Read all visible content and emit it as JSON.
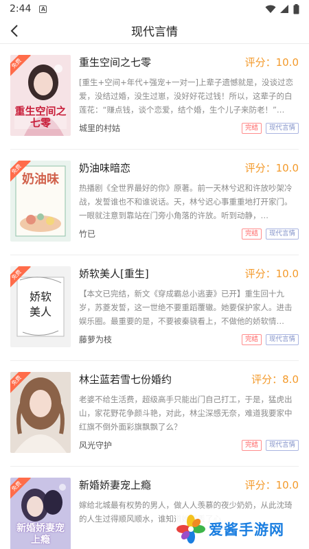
{
  "status": {
    "time": "2:44"
  },
  "nav": {
    "title": "现代言情"
  },
  "books": [
    {
      "title": "重生空间之七零",
      "score": "评分：10.0",
      "desc": "[重生+空间+年代+强宠+一对一]上辈子遗憾就是，没谈过恋爱，没结过婚，没生过崽，没好好花过钱！所以，这辈子的白莲花：“赚点钱，谈个恋爱，结个婚，生个儿子来防老！”…",
      "author": "城里的村姑",
      "status_tag": "完结",
      "genre_tag": "现代言情",
      "badge": "免费",
      "cover_text": "重生空间之七零"
    },
    {
      "title": "奶油味暗恋",
      "score": "评分：10.0",
      "desc": "热播剧《全世界最好的你》原著。前一天林兮迟和许放吵架冷战，发誓谁也不和谁说话。天，林兮迟心事重重地打开家门。一眼就注意到靠站在门旁小角落的许放。听到动静，…",
      "author": "竹已",
      "status_tag": "完结",
      "genre_tag": "现代言情",
      "badge": "免费",
      "cover_text": "奶油味"
    },
    {
      "title": "娇软美人[重生]",
      "score": "评分：10.0",
      "desc": "【本文已完结，新文《穿成霸总小逃妻》已开】重生回十九岁，苏菱发誓，这一世绝不要重蹈覆辙。她要保护家人。进击娱乐圈。最重要的是，不要被秦骁看上，不做他的娇软情…",
      "author": "藤萝为枝",
      "status_tag": "完结",
      "genre_tag": "现代言情",
      "badge": "免费",
      "cover_text": "娇软美人"
    },
    {
      "title": "林尘蓝若雪七份婚约",
      "score": "评分：8.0",
      "desc": "老婆不给生活费，超级高手只能出门自己打工，于是，猛虎出山，家花野花争颜斗艳，对此，林尘深感无奈，难道我要家中红旗不倒外面彩旗飘飘了么？",
      "author": "风光守护",
      "status_tag": "完结",
      "genre_tag": "现代言情",
      "badge": "免费",
      "cover_text": ""
    },
    {
      "title": "新婚娇妻宠上瘾",
      "score": "评分：10.0",
      "desc": "嫁给北城最有权势的男人，做人人羡慕的夜少奶奶，从此沈琦的人生过得顺风顺水，谁知道她竟丢了心……",
      "author": "",
      "status_tag": "",
      "genre_tag": "",
      "badge": "免费",
      "cover_text": "新婚娇妻宠上瘾"
    }
  ],
  "watermark": {
    "text": "爱酱手游网"
  },
  "colors": {
    "score": "#f39a2b",
    "done_tag": "#ff5b5b",
    "genre_tag": "#8090c8",
    "badge": "#ff6c4a"
  }
}
